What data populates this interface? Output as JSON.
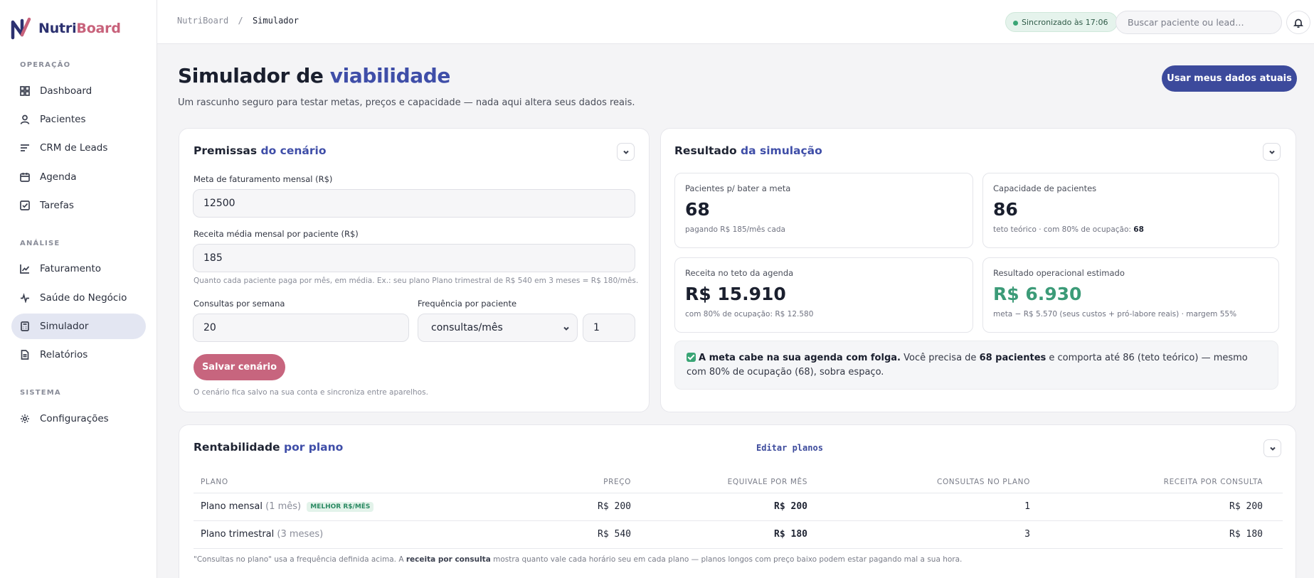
{
  "app": {
    "name_part1": "Nutri",
    "name_part2": "Board"
  },
  "sidebar": {
    "sections": [
      {
        "label": "OPERAÇÃO"
      },
      {
        "label": "ANÁLISE"
      },
      {
        "label": "SISTEMA"
      }
    ],
    "items": [
      {
        "label": "Dashboard",
        "icon": "grid-icon"
      },
      {
        "label": "Pacientes",
        "icon": "user-icon"
      },
      {
        "label": "CRM de Leads",
        "icon": "filter-icon"
      },
      {
        "label": "Agenda",
        "icon": "calendar-icon"
      },
      {
        "label": "Tarefas",
        "icon": "checkbox-icon"
      },
      {
        "label": "Faturamento",
        "icon": "line-chart-icon"
      },
      {
        "label": "Saúde do Negócio",
        "icon": "pulse-icon"
      },
      {
        "label": "Simulador",
        "icon": "calculator-icon",
        "active": true
      },
      {
        "label": "Relatórios",
        "icon": "document-icon"
      },
      {
        "label": "Configurações",
        "icon": "gear-icon"
      }
    ]
  },
  "topbar": {
    "breadcrumb_root": "NutriBoard",
    "breadcrumb_sep": "/",
    "breadcrumb_current": "Simulador",
    "sync_status": "Sincronizado às 17:06",
    "search_placeholder": "Buscar paciente ou lead…"
  },
  "page": {
    "title_plain": "Simulador de",
    "title_accent": "viabilidade",
    "subtitle": "Um rascunho seguro para testar metas, preços e capacidade — nada aqui altera seus dados reais.",
    "primary_button": "Usar meus dados atuais"
  },
  "premissas": {
    "title_plain": "Premissas",
    "title_accent": "do cenário",
    "meta_label": "Meta de faturamento mensal (R$)",
    "meta_value": "12500",
    "receita_label": "Receita média mensal por paciente (R$)",
    "receita_value": "185",
    "receita_hint": "Quanto cada paciente paga por mês, em média. Ex.: seu plano Plano trimestral de R$ 540 em 3 meses = R$ 180/mês.",
    "consultas_label": "Consultas por semana",
    "consultas_value": "20",
    "frequencia_label": "Frequência por paciente",
    "frequencia_unit": "consultas/mês",
    "frequencia_value": "1",
    "save_button": "Salvar cenário",
    "save_hint": "O cenário fica salvo na sua conta e sincroniza entre aparelhos."
  },
  "resultado": {
    "title_plain": "Resultado",
    "title_accent": "da simulação",
    "metrics": [
      {
        "label": "Pacientes p/ bater a meta",
        "value": "68",
        "sub": "pagando R$ 185/mês cada"
      },
      {
        "label": "Capacidade de pacientes",
        "value": "86",
        "sub_prefix": "teto teórico · com 80% de ocupação:",
        "sub_strong": "68"
      },
      {
        "label": "Receita no teto da agenda",
        "value": "R$ 15.910",
        "sub": "com 80% de ocupação: R$ 12.580"
      },
      {
        "label": "Resultado operacional estimado",
        "value": "R$ 6.930",
        "sub": "meta − R$ 5.570 (seus custos + pró-labore reais) · margem 55%",
        "value_color": "#3c9b78"
      }
    ],
    "notice_strong": "A meta cabe na sua agenda com folga.",
    "notice_text1": "Você precisa de",
    "notice_strong2": "68 pacientes",
    "notice_text2": "e comporta até 86 (teto teórico) — mesmo com 80% de ocupação (68), sobra espaço."
  },
  "rentabilidade": {
    "title_plain": "Rentabilidade",
    "title_accent": "por plano",
    "edit_link": "Editar planos",
    "headers": [
      "PLANO",
      "PREÇO",
      "EQUIVALE POR MÊS",
      "CONSULTAS NO PLANO",
      "RECEITA POR CONSULTA"
    ],
    "rows": [
      {
        "name": "Plano mensal",
        "duration": "(1 mês)",
        "badge": "MELHOR R$/MÊS",
        "price": "R$ 200",
        "monthly": "R$ 200",
        "consultas": "1",
        "per_consulta": "R$ 200"
      },
      {
        "name": "Plano trimestral",
        "duration": "(3 meses)",
        "badge": "",
        "price": "R$ 540",
        "monthly": "R$ 180",
        "consultas": "3",
        "per_consulta": "R$ 180"
      }
    ],
    "foot_text1": "\"Consultas no plano\" usa a frequência definida acima. A",
    "foot_strong": "receita por consulta",
    "foot_text2": "mostra quanto vale cada horário seu em cada plano — planos longos com preço baixo podem estar pagando mal a sua hora."
  },
  "colors": {
    "accent": "#3f4ea8",
    "brand_pink": "#c7657e",
    "success": "#3aa575"
  }
}
